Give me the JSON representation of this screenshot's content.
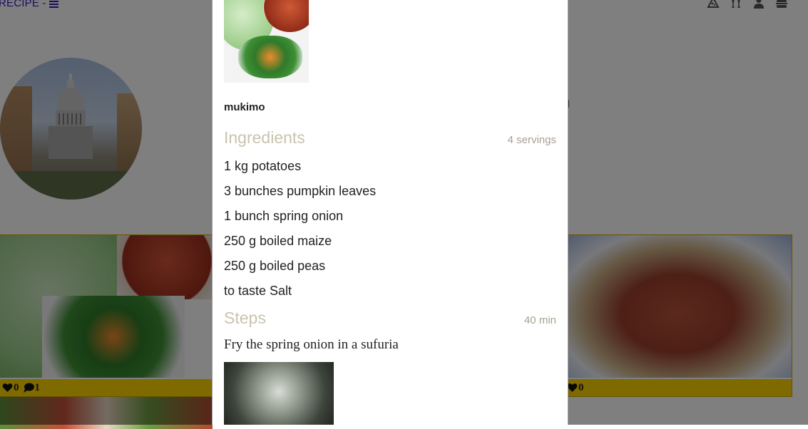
{
  "app": {
    "brand": "RECIPE -",
    "brand_icon": "bars-icon",
    "nav_icons": [
      "pizza-icon",
      "cheers-icon",
      "user-icon",
      "burger-icon"
    ]
  },
  "profile": {
    "photo": "capitol-building-photo",
    "bio_fragment": "g"
  },
  "cards": [
    {
      "image": "mukimo-photo",
      "likes": "0",
      "comments": "1"
    },
    {
      "image": "githeri-beans-photo",
      "likes": "0"
    }
  ],
  "modal": {
    "recipe": {
      "image": "mukimo-photo",
      "title": "mukimo",
      "ingredients_heading": "Ingredients",
      "servings": "4 servings",
      "ingredients": [
        "1 kg potatoes",
        "3 bunches pumpkin leaves",
        "1 bunch spring onion",
        "250 g boiled maize",
        "250 g boiled peas",
        "to taste Salt"
      ],
      "steps_heading": "Steps",
      "duration": "40 min",
      "steps": [
        {
          "text": "Fry the spring onion in a sufuria",
          "image": "frying-onion-photo"
        }
      ]
    }
  },
  "colors": {
    "brand": "#2f1ac4",
    "card_bar": "#ffd400",
    "section_heading": "#c9c3ae"
  }
}
